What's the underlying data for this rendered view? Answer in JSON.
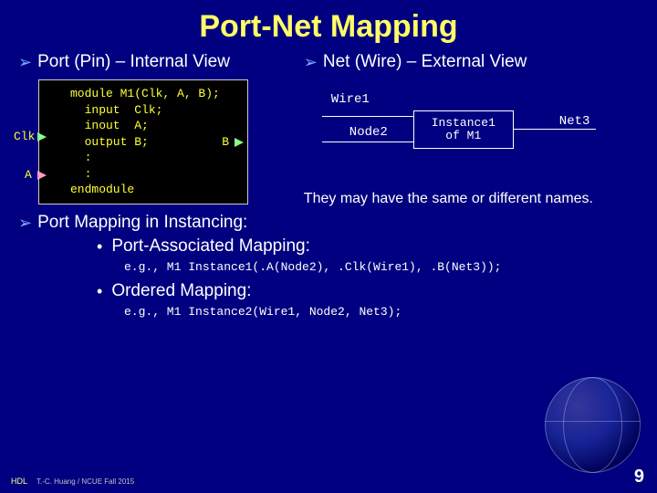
{
  "title": "Port-Net Mapping",
  "left": {
    "heading": "Port (Pin) – Internal View",
    "code": {
      "l1": "module M1(Clk, A, B);",
      "l2": "  input  Clk;",
      "l3": "  inout  A;",
      "l4": "  output B;",
      "l5": "  :",
      "l6": "  :",
      "l7": "endmodule"
    },
    "ports": {
      "clk": "Clk",
      "a": "A",
      "b": "B"
    }
  },
  "right": {
    "heading": "Net (Wire) – External View",
    "wires": {
      "w1": "Wire1",
      "n2": "Node2",
      "n3": "Net3"
    },
    "inst_line1": "Instance1",
    "inst_line2": "of M1",
    "note": "They may have the same or different names."
  },
  "mapping": {
    "heading": "Port Mapping in Instancing:",
    "pa_label": "Port-Associated Mapping:",
    "pa_eg": "e.g., M1 Instance1(.A(Node2), .Clk(Wire1), .B(Net3));",
    "ord_label": "Ordered Mapping:",
    "ord_eg": "e.g., M1 Instance2(Wire1, Node2, Net3);"
  },
  "footer": {
    "hdl": "HDL",
    "author": "T.-C. Huang / NCUE  Fall 2015",
    "page": "9"
  }
}
